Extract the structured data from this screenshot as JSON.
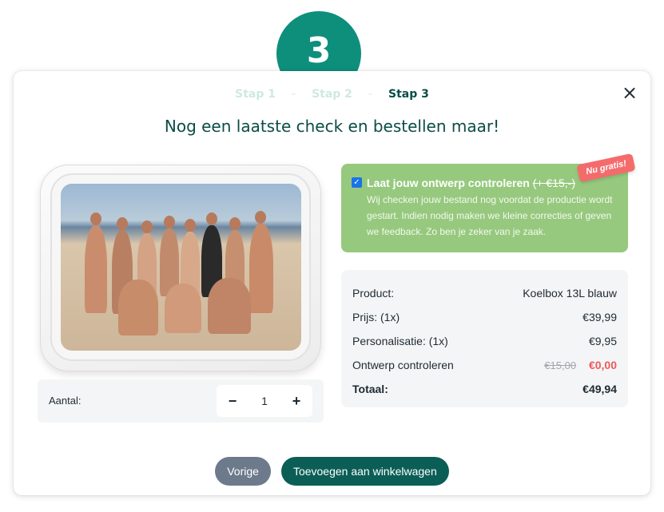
{
  "step_badge": "3",
  "steps": [
    "Stap 1",
    "-",
    "Stap 2",
    "-",
    "Stap 3"
  ],
  "title": "Nog een laatste check en bestellen maar!",
  "close_icon": "×",
  "quantity": {
    "label": "Aantal:",
    "minus": "−",
    "value": "1",
    "plus": "+"
  },
  "review": {
    "checked": true,
    "title": "Laat jouw ontwerp controleren",
    "title_strike": "(+ €15,-)",
    "description": "Wij checken jouw bestand nog voordat de productie wordt gestart. Indien nodig maken we kleine correcties of geven we feedback. Zo ben je zeker van je zaak.",
    "badge": "Nu gratis!"
  },
  "summary": {
    "rows": [
      {
        "label": "Product:",
        "value": "Koelbox 13L blauw"
      },
      {
        "label": "Prijs: (1x)",
        "value": "€39,99"
      },
      {
        "label": "Personalisatie: (1x)",
        "value": "€9,95"
      }
    ],
    "review_row": {
      "label": "Ontwerp controleren",
      "old": "€15,00",
      "new": "€0,00"
    },
    "total": {
      "label": "Totaal:",
      "value": "€49,94"
    }
  },
  "buttons": {
    "prev": "Vorige",
    "add": "Toevoegen aan winkelwagen"
  },
  "colors": {
    "brand": "#0e8f7c",
    "dark_green": "#0b5e56",
    "green_card": "#96c97e",
    "red": "#ee5a5a"
  }
}
